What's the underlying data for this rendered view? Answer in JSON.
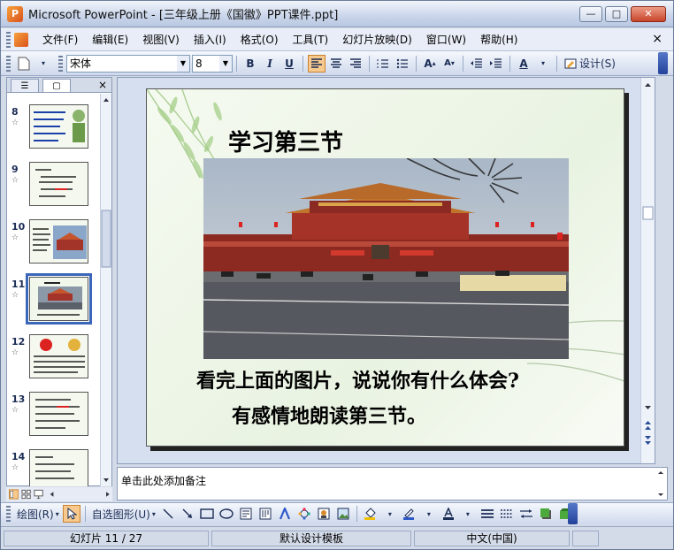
{
  "window": {
    "app_icon_letter": "P",
    "title": "Microsoft PowerPoint - [三年级上册《国徽》PPT课件.ppt]",
    "minimize": "—",
    "maximize": "□",
    "close": "✕"
  },
  "menu": {
    "items": [
      "文件(F)",
      "编辑(E)",
      "视图(V)",
      "插入(I)",
      "格式(O)",
      "工具(T)",
      "幻灯片放映(D)",
      "窗口(W)",
      "帮助(H)"
    ],
    "close": "×"
  },
  "toolbar": {
    "font_name": "宋体",
    "font_size": "8",
    "bold": "B",
    "italic": "I",
    "underline": "U",
    "font_color_letter": "A",
    "design_label": "设计(S)"
  },
  "left_pane": {
    "tab_outline": "☰",
    "tab_slides": "▢",
    "close": "×",
    "thumbnails": [
      {
        "num": "8",
        "star": "☆"
      },
      {
        "num": "9",
        "star": "☆"
      },
      {
        "num": "10",
        "star": "☆"
      },
      {
        "num": "11",
        "star": "☆"
      },
      {
        "num": "12",
        "star": "☆"
      },
      {
        "num": "13",
        "star": "☆"
      },
      {
        "num": "14",
        "star": "☆"
      }
    ]
  },
  "slide": {
    "title": "学习第三节",
    "line1": "看完上面的图片，说说你有什么体会?",
    "line2": "有感情地朗读第三节。"
  },
  "notes": {
    "placeholder": "单击此处添加备注"
  },
  "draw_toolbar": {
    "draw_label": "绘图(R)",
    "autoshapes_label": "自选图形(U)"
  },
  "status": {
    "slide_info": "幻灯片 11 / 27",
    "template": "默认设计模板",
    "language": "中文(中国)"
  },
  "colors": {
    "accent": "#f8c98c",
    "selection": "#3b67b8",
    "slide_bg": "#eef5e8"
  }
}
